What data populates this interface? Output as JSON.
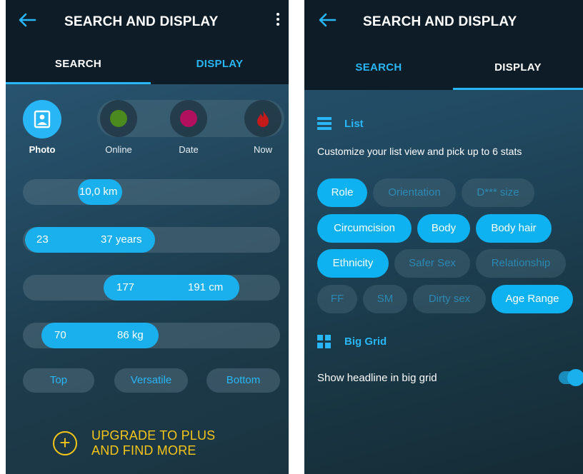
{
  "left": {
    "title": "SEARCH AND DISPLAY",
    "tabs": [
      "SEARCH",
      "DISPLAY"
    ],
    "active_tab": "SEARCH",
    "filters": [
      {
        "label": "Photo",
        "color": "#29b6f6"
      },
      {
        "label": "Online",
        "color": "#4a8a1e"
      },
      {
        "label": "Date",
        "color": "#b0105e"
      },
      {
        "label": "Now",
        "color": "#c41a1a"
      }
    ],
    "distance": {
      "value": "10,0 km"
    },
    "age": {
      "min": "23",
      "max": "37 years"
    },
    "height": {
      "min": "177",
      "max": "191 cm"
    },
    "weight": {
      "min": "70",
      "max": "86 kg"
    },
    "roles": [
      "Top",
      "Versatile",
      "Bottom"
    ],
    "upgrade": {
      "line1": "UPGRADE TO PLUS",
      "line2": "AND FIND MORE"
    }
  },
  "right": {
    "title": "SEARCH AND DISPLAY",
    "tabs": [
      "SEARCH",
      "DISPLAY"
    ],
    "active_tab": "DISPLAY",
    "list_section": {
      "heading": "List",
      "description": "Customize your list view and pick up to 6 stats",
      "chips": [
        {
          "label": "Role",
          "selected": true
        },
        {
          "label": "Orientation",
          "selected": false
        },
        {
          "label": "D*** size",
          "selected": false
        },
        {
          "label": "Circumcision",
          "selected": true
        },
        {
          "label": "Body",
          "selected": true
        },
        {
          "label": "Body hair",
          "selected": true
        },
        {
          "label": "Ethnicity",
          "selected": true
        },
        {
          "label": "Safer Sex",
          "selected": false
        },
        {
          "label": "Relationship",
          "selected": false
        },
        {
          "label": "FF",
          "selected": false
        },
        {
          "label": "SM",
          "selected": false
        },
        {
          "label": "Dirty sex",
          "selected": false
        },
        {
          "label": "Age Range",
          "selected": true
        }
      ]
    },
    "grid_section": {
      "heading": "Big Grid",
      "setting_label": "Show headline in big grid",
      "setting_on": true
    }
  },
  "colors": {
    "accent": "#29b6f6",
    "upgrade": "#f5c518",
    "bar": "#0d1c26"
  }
}
